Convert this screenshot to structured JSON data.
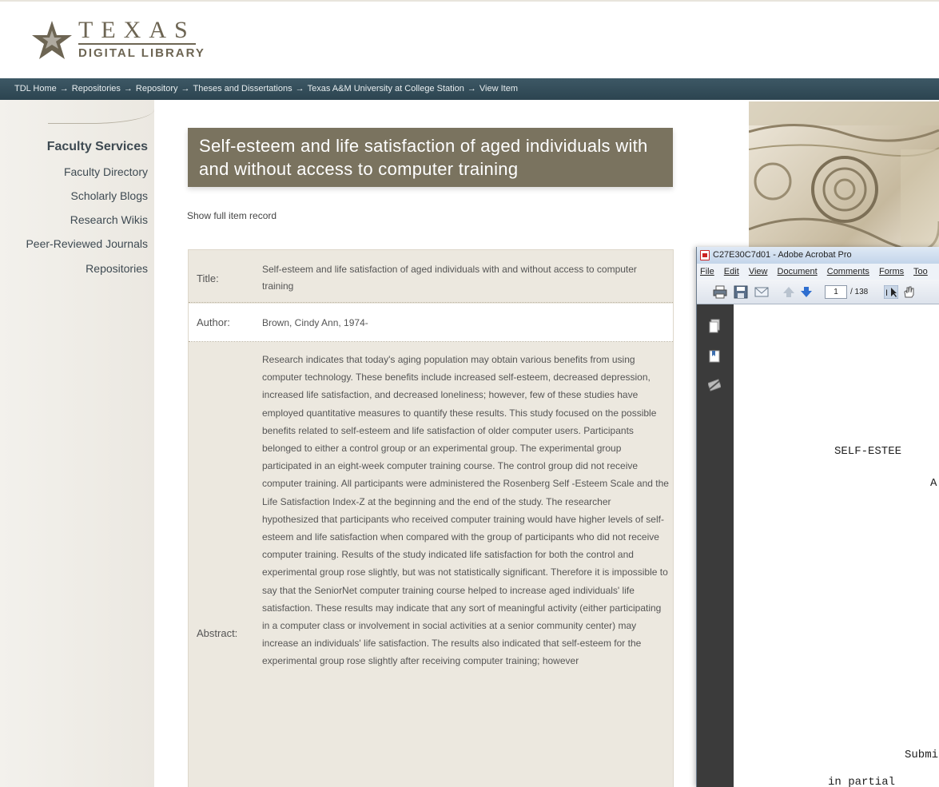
{
  "header": {
    "logo_texas": "TEXAS",
    "logo_sub": "DIGITAL LIBRARY"
  },
  "breadcrumb": [
    "TDL Home",
    "Repositories",
    "Repository",
    "Theses and Dissertations",
    "Texas A&M University at College Station",
    "View Item"
  ],
  "breadcrumb_separator": "→",
  "sidebar": {
    "title": "Faculty Services",
    "items": [
      {
        "label": "Faculty Directory"
      },
      {
        "label": "Scholarly Blogs"
      },
      {
        "label": "Research Wikis"
      },
      {
        "label": "Peer-Reviewed Journals"
      },
      {
        "label": "Repositories"
      }
    ]
  },
  "item": {
    "heading": "Self-esteem and life satisfaction of aged individuals with and without access to computer training",
    "show_full_record": "Show full item record",
    "fields": {
      "title_label": "Title:",
      "title_value": "Self-esteem and life satisfaction of aged individuals with and without access to computer training",
      "author_label": "Author:",
      "author_value": "Brown, Cindy Ann, 1974-",
      "abstract_label": "Abstract:",
      "abstract_value": "Research indicates that today's aging population may obtain various benefits from using computer technology. These benefits include increased self-esteem, decreased depression, increased life satisfaction, and decreased loneliness; however, few of these studies have employed quantitative measures to quantify these results. This study focused on the possible benefits related to self-esteem and life satisfaction of older computer users. Participants belonged to either a control group or an experimental group. The experimental group participated in an eight-week computer training course. The control group did not receive computer training. All participants were administered the Rosenberg Self -Esteem Scale and the Life Satisfaction Index-Z at the beginning and the end of the study. The researcher hypothesized that participants who received computer training would have higher levels of self-esteem and life satisfaction when compared with the group of participants who did not receive computer training. Results of the study indicated life satisfaction for both the control and experimental group rose slightly, but was not statistically significant. Therefore it is impossible to say that the SeniorNet computer training course helped to increase aged individuals' life satisfaction. These results may indicate that any sort of meaningful activity (either participating in a computer class or involvement in social activities at a senior community center) may increase an individuals' life satisfaction. The results also indicated that self-esteem for the experimental group rose slightly after receiving computer training; however"
    }
  },
  "acrobat": {
    "window_title": "C27E30C7d01 - Adobe Acrobat Pro",
    "menu": [
      "File",
      "Edit",
      "View",
      "Document",
      "Comments",
      "Forms",
      "Too"
    ],
    "page_current": "1",
    "page_total": "/ 138",
    "doc_lines": {
      "line1": "SELF-ESTEE",
      "line2": "A",
      "line3": "Submi",
      "line4": "in partial"
    }
  },
  "colors": {
    "title_bg": "#7a735f",
    "breadcrumb_bg": "#2c4450",
    "record_bg": "#ece8df",
    "logo": "#6d6553"
  }
}
